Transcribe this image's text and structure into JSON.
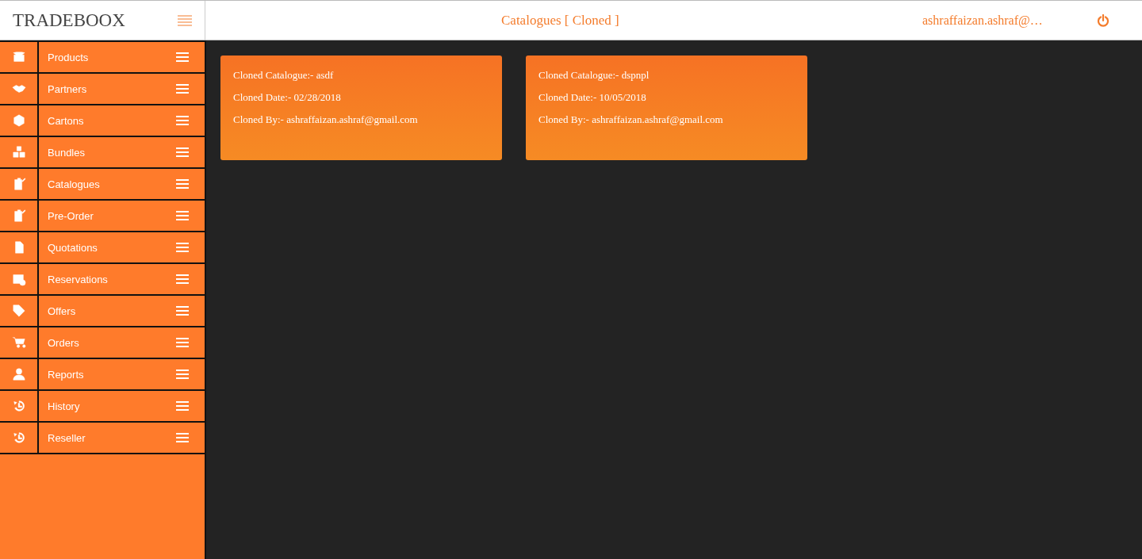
{
  "header": {
    "logo": "TRADEBOOX",
    "title": "Catalogues [ Cloned ]",
    "user": "ashraffaizan.ashraf@…"
  },
  "sidebar": {
    "items": [
      {
        "label": "Products"
      },
      {
        "label": "Partners"
      },
      {
        "label": "Cartons"
      },
      {
        "label": "Bundles"
      },
      {
        "label": "Catalogues"
      },
      {
        "label": "Pre-Order"
      },
      {
        "label": "Quotations"
      },
      {
        "label": "Reservations"
      },
      {
        "label": "Offers"
      },
      {
        "label": "Orders"
      },
      {
        "label": "Reports"
      },
      {
        "label": "History"
      },
      {
        "label": "Reseller"
      }
    ]
  },
  "cards": [
    {
      "lines": [
        "Cloned Catalogue:- asdf",
        "Cloned Date:- 02/28/2018",
        "Cloned By:- ashraffaizan.ashraf@gmail.com"
      ]
    },
    {
      "lines": [
        "Cloned Catalogue:- dspnpl",
        "Cloned Date:- 10/05/2018",
        "Cloned By:- ashraffaizan.ashraf@gmail.com"
      ]
    }
  ]
}
